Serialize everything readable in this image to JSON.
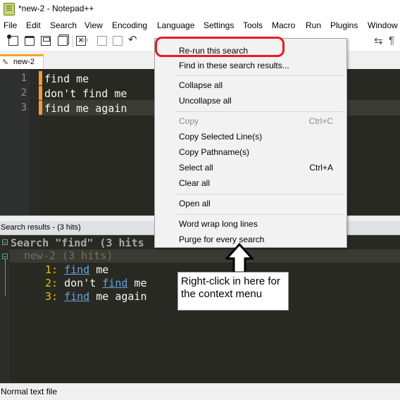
{
  "window": {
    "title": "*new-2 - Notepad++"
  },
  "menu": [
    "File",
    "Edit",
    "Search",
    "View",
    "Encoding",
    "Language",
    "Settings",
    "Tools",
    "Macro",
    "Run",
    "Plugins",
    "Window"
  ],
  "toolbar": {
    "icons": [
      "new-file-icon",
      "open-file-icon",
      "save-icon",
      "save-all-icon",
      "close-icon",
      "cut-icon",
      "copy-icon",
      "paste-icon",
      "undo-icon"
    ],
    "right_icons": [
      "find-icon",
      "pilcrow-icon"
    ]
  },
  "tab": {
    "label": "new-2",
    "icon": "pencil-icon"
  },
  "editor": {
    "lines": [
      {
        "number": "1",
        "text": "find me"
      },
      {
        "number": "2",
        "text": "don't find me"
      },
      {
        "number": "3",
        "text": "find me again"
      }
    ]
  },
  "results": {
    "header": "Search results - (3 hits)",
    "search_line": "Search \"find\" (3 hits",
    "file_line": "new-2 (3 hits)",
    "hits": [
      {
        "num": "1:",
        "pre": "",
        "match": "find",
        "post": " me"
      },
      {
        "num": "2:",
        "pre": "don't ",
        "match": "find",
        "post": " me"
      },
      {
        "num": "3:",
        "pre": "",
        "match": "find",
        "post": " me again"
      }
    ]
  },
  "context_menu": {
    "items": [
      {
        "label": "Re-run this search",
        "shortcut": "",
        "disabled": false
      },
      {
        "label": "Find in these search results...",
        "shortcut": "",
        "disabled": false
      },
      {
        "label": "Collapse all",
        "shortcut": "",
        "disabled": false
      },
      {
        "label": "Uncollapse all",
        "shortcut": "",
        "disabled": false
      },
      {
        "label": "Copy",
        "shortcut": "Ctrl+C",
        "disabled": true
      },
      {
        "label": "Copy Selected Line(s)",
        "shortcut": "",
        "disabled": false
      },
      {
        "label": "Copy Pathname(s)",
        "shortcut": "",
        "disabled": false
      },
      {
        "label": "Select all",
        "shortcut": "Ctrl+A",
        "disabled": false
      },
      {
        "label": "Clear all",
        "shortcut": "",
        "disabled": false
      },
      {
        "label": "Open all",
        "shortcut": "",
        "disabled": false
      },
      {
        "label": "Word wrap long lines",
        "shortcut": "",
        "disabled": false
      },
      {
        "label": "Purge for every search",
        "shortcut": "",
        "disabled": false
      }
    ]
  },
  "annotation": {
    "text": "Right-click in here for the context menu"
  },
  "statusbar": {
    "text": "Normal text file"
  },
  "colors": {
    "editor_bg": "#282923",
    "highlight_red": "#e81b25",
    "tab_accent": "#f7a32b",
    "change_marker": "#f19d3a",
    "link_blue": "#66a4e0",
    "line_number_yellow": "#e6c300"
  }
}
